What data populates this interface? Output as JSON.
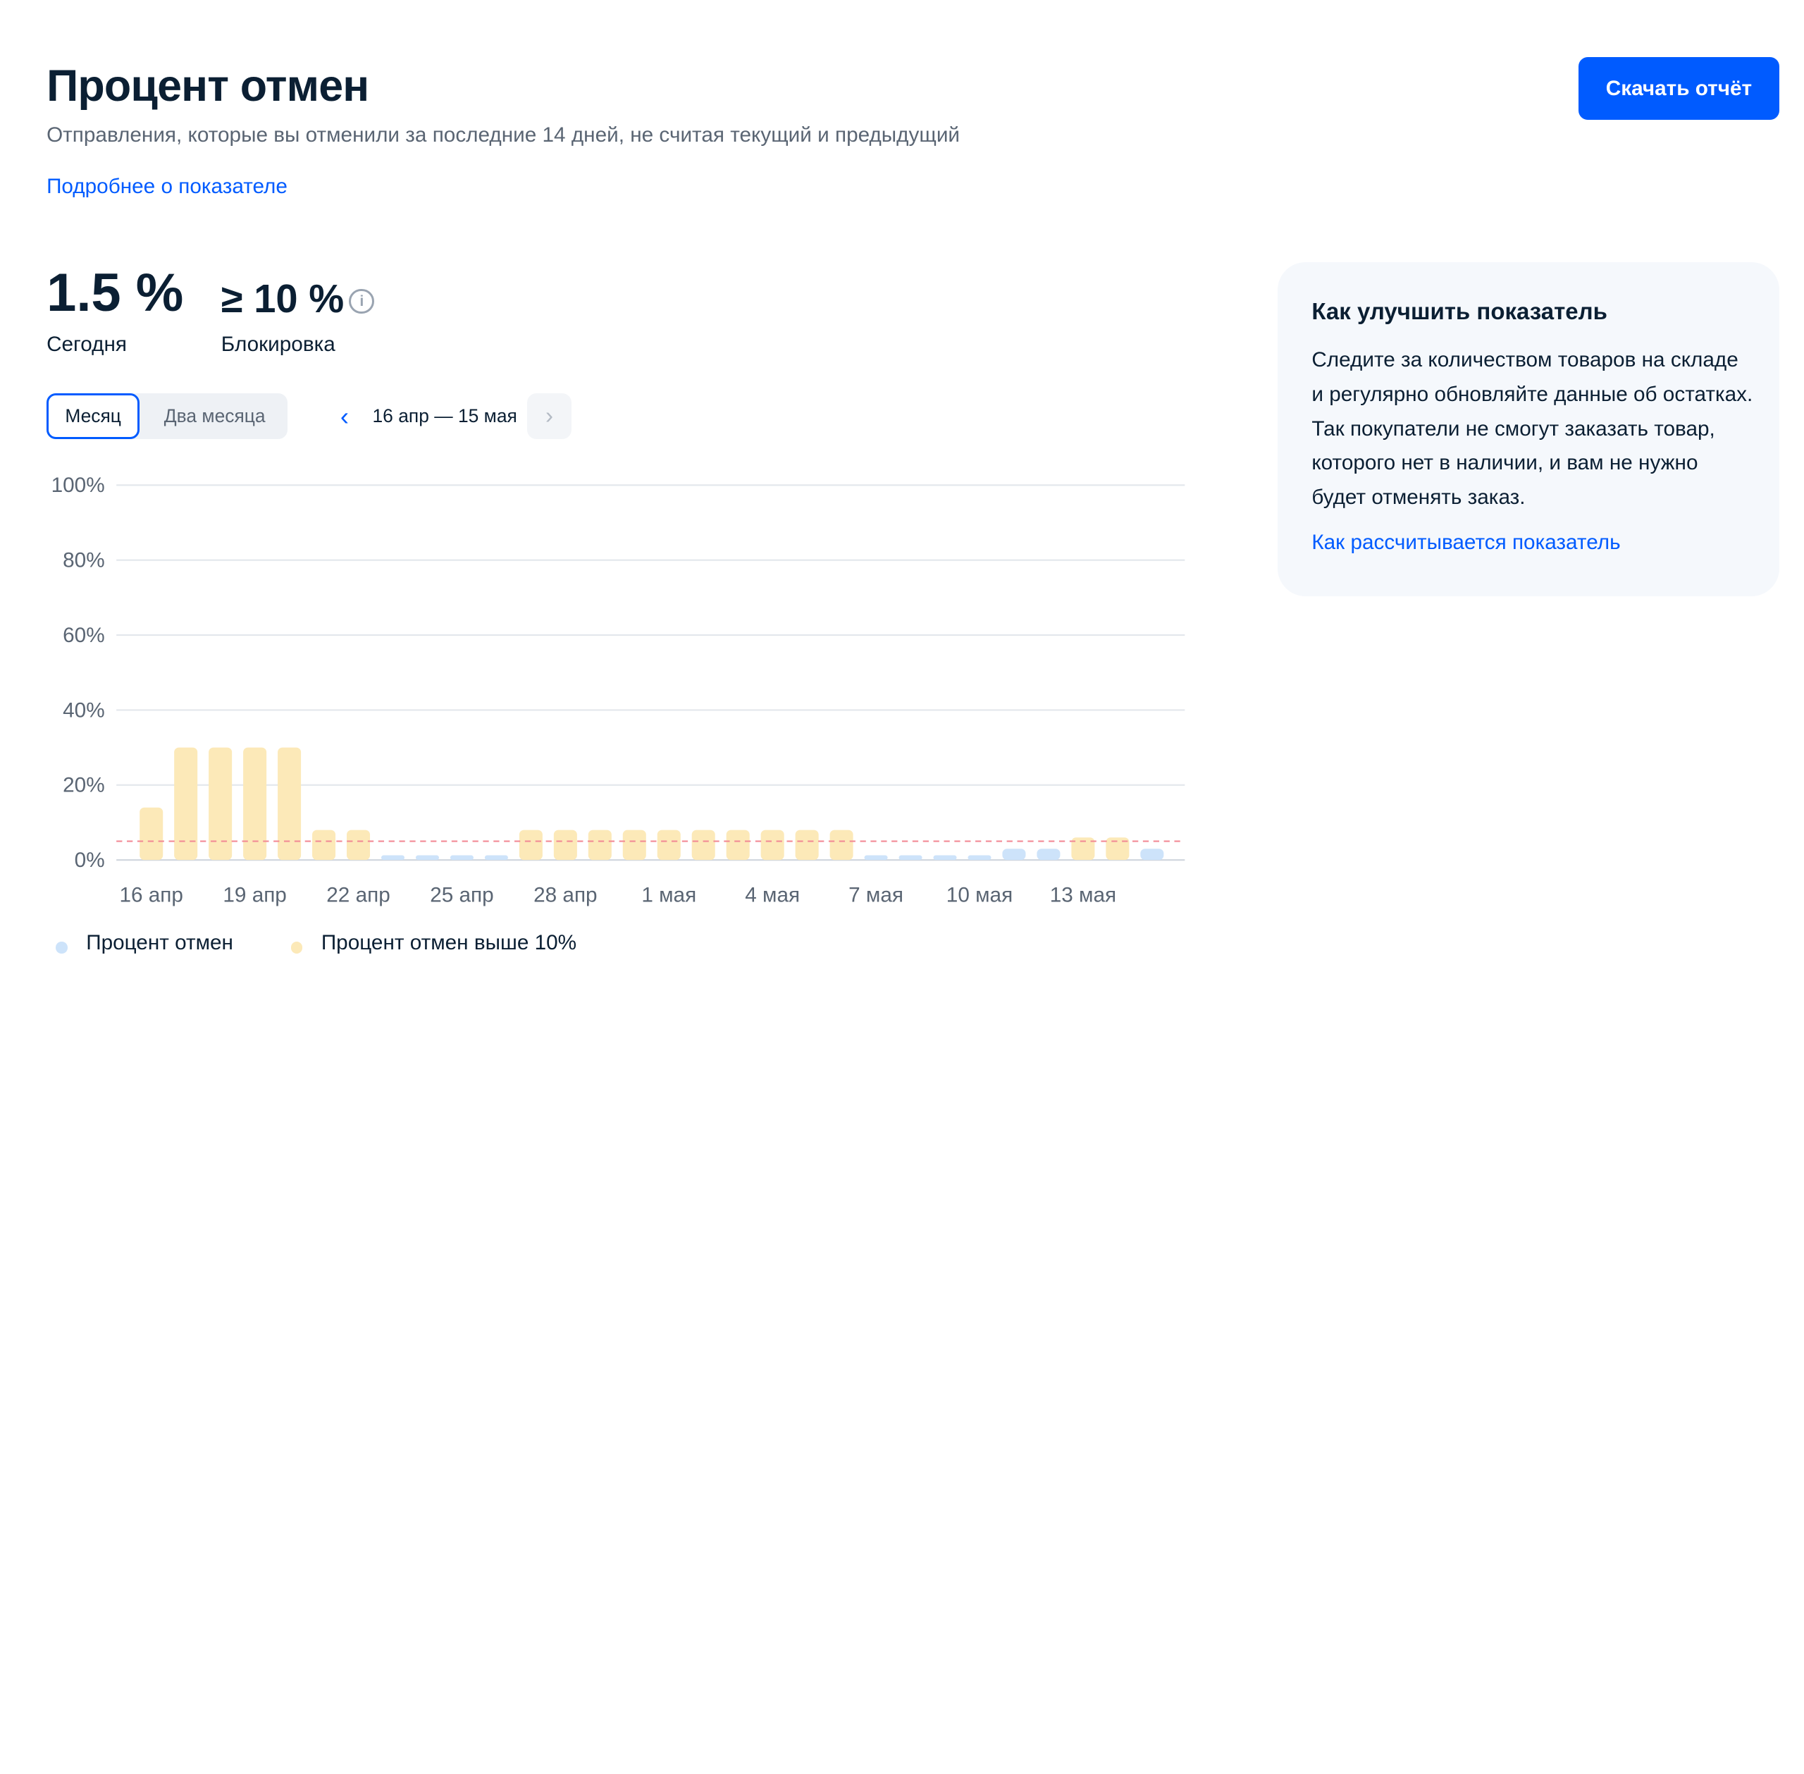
{
  "header": {
    "title": "Процент отмен",
    "subtitle": "Отправления, которые вы отменили за последние 14 дней, не считая текущий и предыдущий",
    "more_link": "Подробнее о показателе",
    "download_label": "Скачать отчёт"
  },
  "metrics": {
    "today_value": "1.5 %",
    "today_label": "Сегодня",
    "block_value": "≥ 10 %",
    "block_label": "Блокировка",
    "info_icon": "info-icon"
  },
  "period": {
    "month_label": "Месяц",
    "two_months_label": "Два месяца",
    "selected": "Месяц",
    "range_label": "16 апр — 15 мая",
    "prev_icon": "chevron-left-icon",
    "next_icon": "chevron-right-icon"
  },
  "tips": {
    "title": "Как улучшить показатель",
    "text": "Следите за количеством товаров на складе и регулярно обновляйте данные об остатках. Так покупатели не смогут заказать товар, которого нет в наличии, и вам не нужно будет отменять заказ.",
    "link": "Как рассчитывается показатель"
  },
  "colors": {
    "accent": "#005bff",
    "below_threshold": "#cde3fa",
    "above_threshold": "#fce9b8",
    "threshold_line": "#f28b96"
  },
  "chart_data": {
    "type": "bar",
    "categories": [
      "16 апр",
      "17 апр",
      "18 апр",
      "19 апр",
      "20 апр",
      "21 апр",
      "22 апр",
      "23 апр",
      "24 апр",
      "25 апр",
      "26 апр",
      "27 апр",
      "28 апр",
      "29 апр",
      "30 апр",
      "1 мая",
      "2 мая",
      "3 мая",
      "4 мая",
      "5 мая",
      "6 мая",
      "7 мая",
      "8 мая",
      "9 мая",
      "10 мая",
      "11 мая",
      "12 мая",
      "13 мая",
      "14 мая",
      "15 мая"
    ],
    "values": [
      14,
      30,
      30,
      30,
      30,
      8,
      8,
      1,
      1,
      1,
      1,
      8,
      8,
      8,
      8,
      8,
      8,
      8,
      8,
      8,
      8,
      1,
      1,
      1,
      1,
      3,
      3,
      6,
      6,
      3
    ],
    "highlight": [
      true,
      true,
      true,
      true,
      true,
      true,
      true,
      false,
      false,
      false,
      false,
      true,
      true,
      true,
      true,
      true,
      true,
      true,
      true,
      true,
      true,
      false,
      false,
      false,
      false,
      false,
      false,
      true,
      true,
      false
    ],
    "x_tick_labels": [
      "16 апр",
      "19 апр",
      "22 апр",
      "25 апр",
      "28 апр",
      "1 мая",
      "4 мая",
      "7 мая",
      "10 мая",
      "13 мая"
    ],
    "x_tick_indices": [
      0,
      3,
      6,
      9,
      12,
      15,
      18,
      21,
      24,
      27
    ],
    "y_ticks": [
      0,
      20,
      40,
      60,
      80,
      100
    ],
    "y_tick_labels": [
      "0%",
      "20%",
      "40%",
      "60%",
      "80%",
      "100%"
    ],
    "ylim": [
      0,
      100
    ],
    "threshold": 5,
    "grid": true,
    "legend": [
      {
        "name": "Процент отмен",
        "color": "#cde3fa"
      },
      {
        "name": "Процент отмен выше 10%",
        "color": "#fce9b8"
      }
    ],
    "legend_position": "bottom-left"
  }
}
